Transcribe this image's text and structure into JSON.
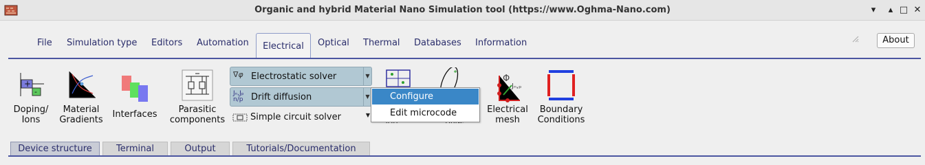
{
  "window": {
    "title": "Organic and hybrid Material Nano Simulation tool (https://www.Oghma-Nano.com)",
    "controls": [
      "▾",
      "▴",
      "□",
      "✕"
    ]
  },
  "menu": {
    "tabs": [
      "File",
      "Simulation type",
      "Editors",
      "Automation",
      "Electrical",
      "Optical",
      "Thermal",
      "Databases",
      "Information"
    ],
    "active": "Electrical",
    "about_label": "About"
  },
  "ribbon": {
    "doping": {
      "line1": "Doping/",
      "line2": "Ions"
    },
    "gradients": {
      "line1": "Material",
      "line2": "Gradients"
    },
    "interfaces": {
      "line1": "Interfaces"
    },
    "parasitic": {
      "line1": "Parasitic",
      "line2": "components"
    },
    "solver_combos": {
      "electrostatic": "Electrostatic solver",
      "drift": "Drift diffusion",
      "circuit": "Simple circuit solver"
    },
    "electrical_mesh": {
      "line1": "Electrical",
      "line2": "mesh"
    },
    "boundary": {
      "line1": "Boundary",
      "line2": "Conditions"
    },
    "hidden_labels": {
      "a": "...ion solver",
      "b": "...olver"
    }
  },
  "dropdown": {
    "items": [
      "Configure",
      "Edit microcode"
    ],
    "highlighted": "Configure",
    "highlight_color": "#3a87c7"
  },
  "bottom_tabs": [
    "Device structure",
    "Terminal",
    "Output",
    "Tutorials/Documentation"
  ],
  "colors": {
    "accent": "#4b55a0",
    "combo_bg": "#b1c8d3"
  }
}
